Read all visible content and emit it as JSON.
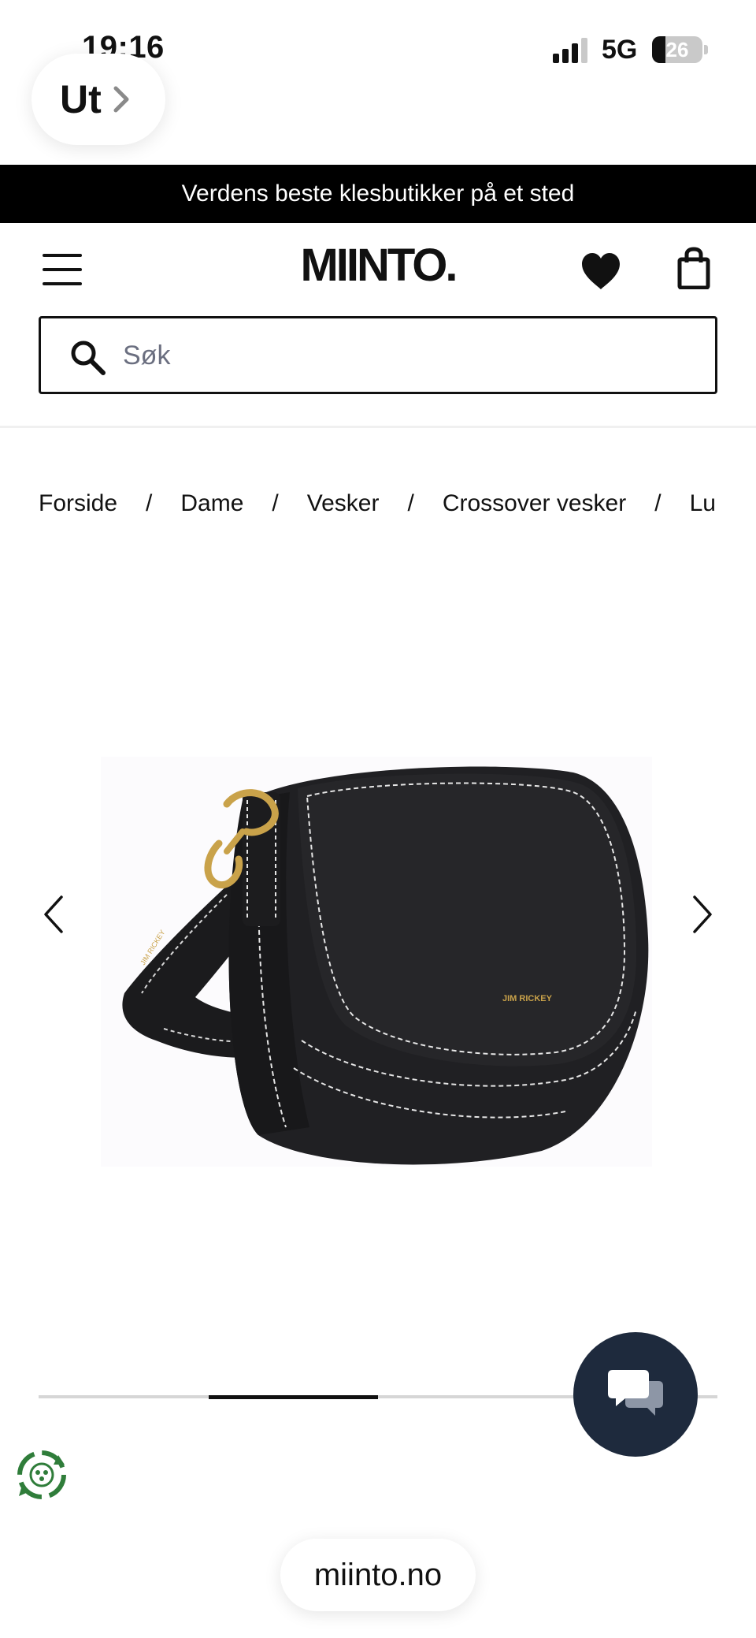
{
  "status_bar": {
    "time": "19:16",
    "back_label": "Ut",
    "network": "5G",
    "battery_level": "26"
  },
  "promo_banner": {
    "text": "Verdens beste klesbutikker på et sted"
  },
  "header": {
    "logo": "MIINTO."
  },
  "search": {
    "placeholder": "Søk",
    "value": ""
  },
  "breadcrumb": {
    "items": [
      "Forside",
      "Dame",
      "Vesker",
      "Crossover vesker",
      "Lu"
    ],
    "separator": "/"
  },
  "gallery": {
    "product_image_text": "JIM RICKEY",
    "progress_fraction": 0.25,
    "progress_segment_index": 1
  },
  "browser": {
    "url": "miinto.no"
  },
  "colors": {
    "banner_bg": "#000000",
    "chat_bg": "#1e2a3d",
    "eco_green": "#2f7d3a",
    "accent_gold": "#c9a24a"
  },
  "icons": [
    "chevron-right-icon",
    "signal-icon",
    "battery-icon",
    "menu-icon",
    "heart-icon",
    "bag-icon",
    "search-icon",
    "chevron-left-icon",
    "chat-icon",
    "eco-badge-icon"
  ]
}
